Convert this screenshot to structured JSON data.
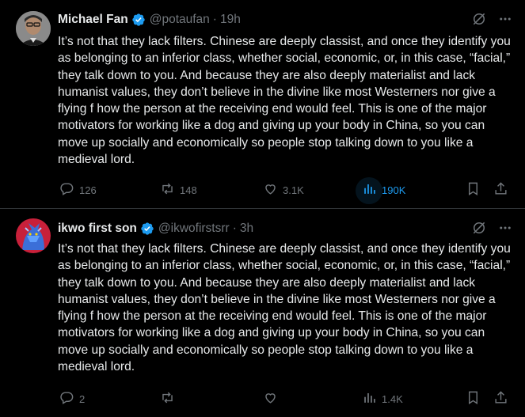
{
  "tweets": [
    {
      "name": "Michael Fan",
      "handle": "@potaufan",
      "dot": "·",
      "time": "19h",
      "text": "It’s not that they lack filters. Chinese are deeply classist, and once they identify you as belonging to an inferior class, whether social, economic, or, in this case, “facial,” they talk down to you. And because they are also deeply materialist and lack humanist values, they don’t believe in the divine like most Westerners nor give a flying f how the person at the receiving end would feel. This is one of the major motivators for working like a dog and giving up your body in China, so you can move up socially and economically so people stop talking down to you like a medieval lord.",
      "replies": "126",
      "reposts": "148",
      "likes": "3.1K",
      "views": "190K",
      "avatar_icon": "user-avatar-man",
      "views_highlight": true
    },
    {
      "name": "ikwo first son",
      "handle": "@ikwofirstsrr",
      "dot": "·",
      "time": "3h",
      "text": "It’s not that they lack filters. Chinese are deeply classist, and once they identify you as belonging to an inferior class, whether social, economic, or, in this case, “facial,” they talk down to you. And because they are also deeply materialist and lack humanist values, they don’t believe in the divine like most Westerners nor give a flying f how the person at the receiving end would feel. This is one of the major motivators for working like a dog and giving up your body in China, so you can move up socially and economically so people stop talking down to you like a medieval lord.",
      "replies": "2",
      "reposts": "",
      "likes": "",
      "views": "1.4K",
      "avatar_icon": "user-avatar-dragon",
      "views_highlight": false
    }
  ],
  "colors": {
    "background": "#000000",
    "text": "#e7e9ea",
    "muted": "#71767b",
    "accent": "#1d9bf0",
    "divider": "#2f3336"
  },
  "icons": [
    "verified-badge-icon",
    "grok-icon",
    "more-icon",
    "reply-icon",
    "repost-icon",
    "like-icon",
    "views-icon",
    "bookmark-icon",
    "share-icon"
  ]
}
